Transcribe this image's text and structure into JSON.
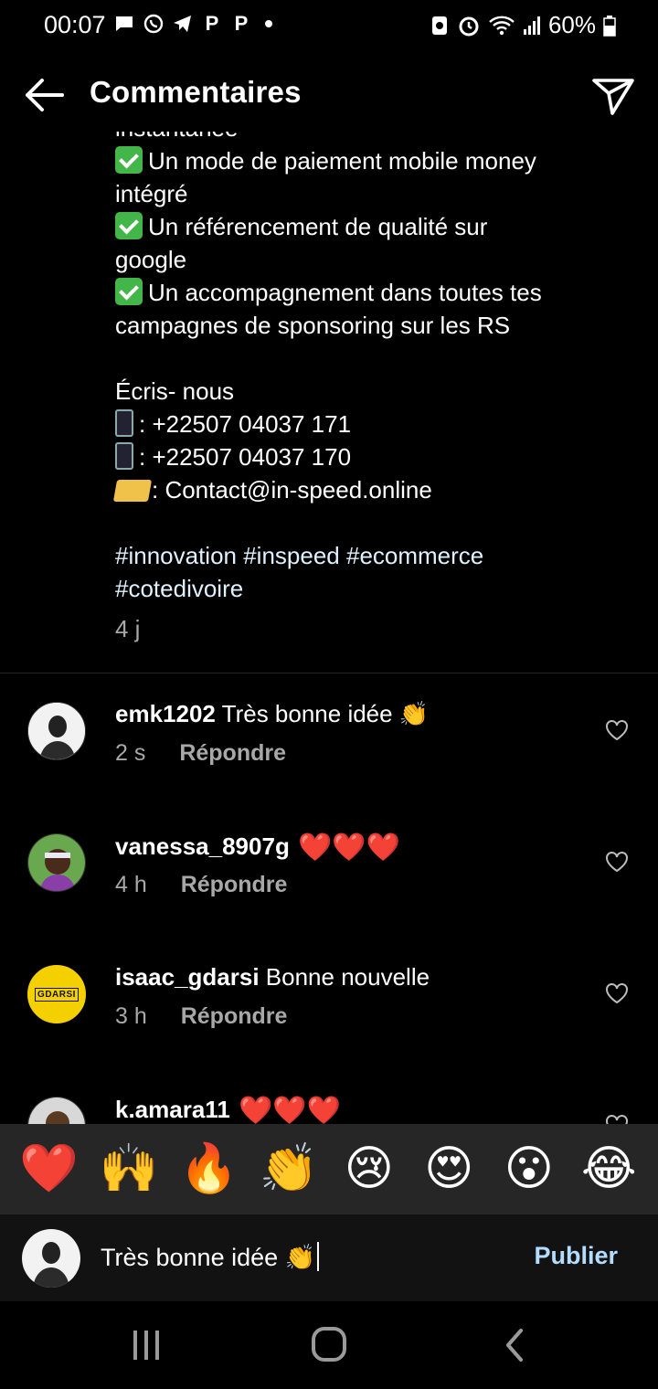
{
  "status_bar": {
    "time": "00:07",
    "left_icons": [
      "message-icon",
      "whatsapp-icon",
      "telegram-icon",
      "p-app-icon",
      "p-app-icon",
      "dot"
    ],
    "battery": "60%"
  },
  "header": {
    "title": "Commentaires"
  },
  "caption": {
    "partial_top": "instantanée",
    "bullets": [
      {
        "line1": "Un mode de paiement mobile money",
        "line2": "intégré"
      },
      {
        "line1": "Un référencement de qualité sur",
        "line2": "google"
      },
      {
        "line1": "Un accompagnement dans toutes tes",
        "line2": "campagnes de sponsoring sur les RS"
      }
    ],
    "contact_heading": "Écris- nous",
    "phone1": ": +22507 04037 171",
    "phone2": ": +22507 04037 170",
    "email": ": Contact@in-speed.online",
    "hashtags_line1": "#innovation #inspeed #ecommerce",
    "hashtags_line2": "#cotedivoire",
    "time": "4 j"
  },
  "comments": [
    {
      "username": "emk1202",
      "text": "Très bonne idée 👏",
      "time": "2 s",
      "reply": "Répondre"
    },
    {
      "username": "vanessa_8907g",
      "text": "❤️❤️❤️",
      "time": "4 h",
      "reply": "Répondre"
    },
    {
      "username": "isaac_gdarsi",
      "text": "Bonne nouvelle",
      "time": "3 h",
      "reply": "Répondre",
      "avatar_text": "GDARSI"
    },
    {
      "username": "k.amara11",
      "text": "❤️❤️❤️"
    }
  ],
  "emoji_bar": [
    "❤️",
    "🙌",
    "🔥",
    "👏",
    "😢",
    "😍",
    "😮",
    "😂"
  ],
  "composer": {
    "input_value": "Très bonne idée 👏",
    "publish_label": "Publier"
  },
  "colors": {
    "background": "#000000",
    "link_blue": "#b3dcff",
    "muted": "#a8a8a8",
    "heart_red": "#e0233a"
  }
}
